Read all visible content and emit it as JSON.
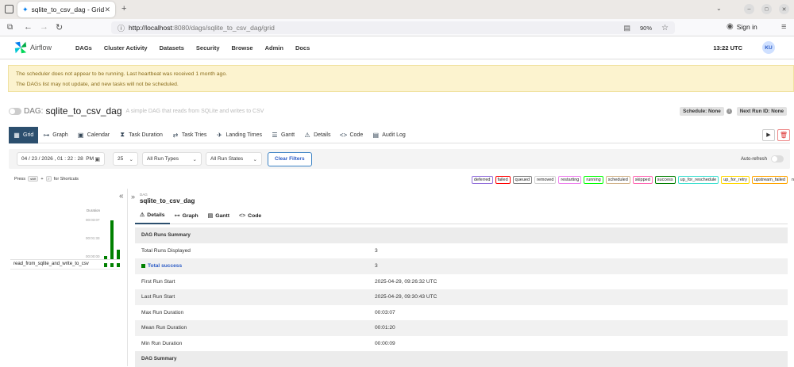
{
  "browser": {
    "tab_title": "sqlite_to_csv_dag - Grid",
    "url_host": "http://localhost",
    "url_path": ":8080/dags/sqlite_to_csv_dag/grid",
    "zoom": "90%",
    "signin": "Sign in"
  },
  "nav": {
    "brand": "Airflow",
    "items": [
      "DAGs",
      "Cluster Activity",
      "Datasets",
      "Security",
      "Browse",
      "Admin",
      "Docs"
    ],
    "time": "13:22 UTC",
    "avatar": "KU"
  },
  "banner": {
    "line1": "The scheduler does not appear to be running. Last heartbeat was received 1 month ago.",
    "line2": "The DAGs list may not update, and new tasks will not be scheduled."
  },
  "dag": {
    "prefix": "DAG:",
    "name": "sqlite_to_csv_dag",
    "description": "A simple DAG that reads from SQLite and writes to CSV",
    "schedule": "Schedule: None",
    "next_run": "Next Run ID: None"
  },
  "tabs": [
    "Grid",
    "Graph",
    "Calendar",
    "Task Duration",
    "Task Tries",
    "Landing Times",
    "Gantt",
    "Details",
    "Code",
    "Audit Log"
  ],
  "filters": {
    "date": "04 / 23 / 2026 , 01 : 22 : 28  PM",
    "count": "25",
    "run_types": "All Run Types",
    "run_states": "All Run States",
    "clear": "Clear Filters",
    "auto_refresh": "Auto-refresh"
  },
  "shortcut_hint": {
    "pre": "Press",
    "key1": "shift",
    "plus": "+",
    "key2": "/",
    "post": "for Shortcuts"
  },
  "legend": [
    "deferred",
    "failed",
    "queued",
    "removed",
    "restarting",
    "running",
    "scheduled",
    "skipped",
    "success",
    "up_for_reschedule",
    "up_for_retry",
    "upstream_failed",
    "no_status"
  ],
  "legend_colors": {
    "deferred": "#9370db",
    "failed": "#ff0000",
    "queued": "#808080",
    "removed": "#d3d3d3",
    "restarting": "#ee82ee",
    "running": "#00ff00",
    "scheduled": "#d2b48c",
    "skipped": "#ff69b4",
    "success": "#008000",
    "up_for_reschedule": "#40e0d0",
    "up_for_retry": "#ffd700",
    "upstream_failed": "#ffa500",
    "no_status": "#ffffff"
  },
  "grid": {
    "duration_label": "Duration",
    "ticks": [
      "00:03:07",
      "00:01:33",
      "00:00:00"
    ],
    "task_name": "read_from_sqlite_and_write_to_csv",
    "run_durations_seconds": [
      9,
      187,
      44
    ]
  },
  "detail": {
    "breadcrumb": "DAG",
    "title": "sqlite_to_csv_dag",
    "subtabs": [
      "Details",
      "Graph",
      "Gantt",
      "Code"
    ],
    "runs_summary_header": "DAG Runs Summary",
    "rows": [
      {
        "k": "Total Runs Displayed",
        "v": "3"
      },
      {
        "k": "Total success",
        "v": "3"
      },
      {
        "k": "First Run Start",
        "v": "2025-04-29, 09:26:32 UTC"
      },
      {
        "k": "Last Run Start",
        "v": "2025-04-29, 09:30:43 UTC"
      },
      {
        "k": "Max Run Duration",
        "v": "00:03:07"
      },
      {
        "k": "Mean Run Duration",
        "v": "00:01:20"
      },
      {
        "k": "Min Run Duration",
        "v": "00:00:09"
      }
    ],
    "dag_summary_header": "DAG Summary"
  },
  "colors": {
    "accent": "#2c4f6e",
    "success": "#008000",
    "link": "#2b5bc6"
  }
}
